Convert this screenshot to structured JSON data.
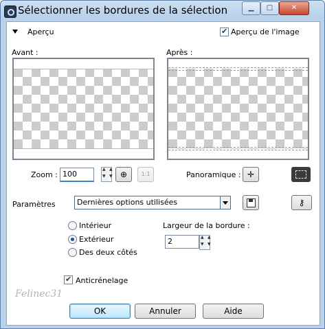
{
  "window": {
    "title": "Sélectionner les bordures de la sélection",
    "controls": {
      "minimize": "▁",
      "maximize": "□",
      "close": "✕"
    }
  },
  "preview_section": {
    "toggle_label": "Aperçu",
    "image_preview_checkbox": {
      "label": "Aperçu de l'image",
      "checked": true
    },
    "before_label": "Avant :",
    "after_label": "Après :",
    "zoom_label": "Zoom :",
    "zoom_value": "100",
    "one_to_one_label": "1:1",
    "pan_label": "Panoramique :"
  },
  "settings": {
    "label": "Paramètres",
    "preset_value": "Dernières options utilisées"
  },
  "options": {
    "inside_label": "Intérieur",
    "outside_label": "Extérieur",
    "both_label": "Des deux côtés",
    "selected": "outside",
    "border_width_label": "Largeur de la bordure :",
    "border_width_value": "2",
    "antialias_label": "Anticrénelage",
    "antialias_checked": true
  },
  "watermark": "Felinec31",
  "buttons": {
    "ok": "OK",
    "cancel": "Annuler",
    "help": "Aide"
  }
}
